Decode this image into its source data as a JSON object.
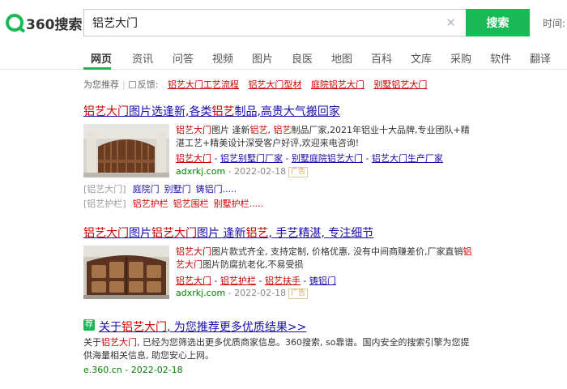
{
  "header": {
    "logo_text": "360搜索",
    "search_value": "铝艺大门",
    "search_button": "搜索",
    "extra_label": "时间:",
    "clear_symbol": "✕"
  },
  "nav": {
    "tabs": [
      {
        "label": "网页",
        "active": true
      },
      {
        "label": "资讯"
      },
      {
        "label": "问答"
      },
      {
        "label": "视频"
      },
      {
        "label": "图片"
      },
      {
        "label": "良医"
      },
      {
        "label": "地图"
      },
      {
        "label": "百科"
      },
      {
        "label": "文库"
      },
      {
        "label": "采购"
      },
      {
        "label": "软件"
      },
      {
        "label": "翻译"
      }
    ]
  },
  "recommend": {
    "prefix": "为您推荐",
    "feedback": "反馈:",
    "links": [
      "铝艺大门工艺流程",
      "铝艺大门型材",
      "庭院铝艺大门",
      "别墅铝艺大门"
    ]
  },
  "results": [
    {
      "title_parts": [
        {
          "t": "铝艺大门",
          "hl": true
        },
        {
          "t": "图片选逢新,各类",
          "hl": false
        },
        {
          "t": "铝艺",
          "hl": true
        },
        {
          "t": "制品,高贵大气搬回家",
          "hl": false
        }
      ],
      "desc_parts": [
        {
          "t": "铝艺大门",
          "hl": true
        },
        {
          "t": "图片 逢新",
          "hl": false
        },
        {
          "t": "铝艺",
          "hl": true
        },
        {
          "t": ", ",
          "hl": false
        },
        {
          "t": "铝艺",
          "hl": true
        },
        {
          "t": "制品厂家,2021年铝业十大品牌,专业团队+精湛工艺+精美设计深受客户好评,欢迎来电咨询!",
          "hl": false
        }
      ],
      "sublinks": [
        "铝艺大门",
        "铝艺别墅门厂家",
        "别墅庭院铝艺大门",
        "铝艺大门生产厂家"
      ],
      "source": "adxrkj.com",
      "date": "2022-02-18",
      "ad": "广告",
      "categories": [
        {
          "label": "[铝艺大门]",
          "links": [
            "庭院门",
            "别墅门",
            "铸铝门....."
          ]
        },
        {
          "label": "[铝艺护栏]",
          "links": [
            "铝艺护栏",
            "铝艺围栏",
            "别墅护栏....."
          ]
        }
      ]
    },
    {
      "title_parts": [
        {
          "t": "铝艺大门",
          "hl": true
        },
        {
          "t": "图片",
          "hl": false
        },
        {
          "t": "铝艺大门",
          "hl": true
        },
        {
          "t": "图片 逢新",
          "hl": false
        },
        {
          "t": "铝艺",
          "hl": true
        },
        {
          "t": ", 手艺精湛, 专注细节",
          "hl": false
        }
      ],
      "desc_parts": [
        {
          "t": "铝艺大门",
          "hl": true
        },
        {
          "t": "图片款式齐全, 支持定制, 价格优惠, 没有中间商赚差价,厂家直销",
          "hl": false
        },
        {
          "t": "铝艺大门",
          "hl": true
        },
        {
          "t": "图片防腐抗老化,不易受损",
          "hl": false
        }
      ],
      "sublinks": [
        "铝艺大门",
        "铝艺护栏",
        "铝艺扶手",
        "铸铝门"
      ],
      "source": "adxrkj.com",
      "date": "2022-02-18",
      "ad": "广告"
    }
  ],
  "more": {
    "badge": "荐",
    "title_prefix": "关于",
    "title_keyword": "铝艺大门",
    "title_suffix": ", 为您推荐更多优质结果>>",
    "desc_prefix": "关于",
    "desc_keyword": "铝艺大门",
    "desc_rest": ", 已经为您筛选出更多优质商家信息。360搜索, so靠谱。国内安全的搜索引擎为您提供海量相关信息, 助您安心上网。",
    "source": "e.360.cn",
    "date": "2022-02-18"
  },
  "colors": {
    "brand_green": "#19b955",
    "link_blue": "#1a0dab",
    "highlight_red": "#cc0000",
    "source_green": "#008000"
  }
}
